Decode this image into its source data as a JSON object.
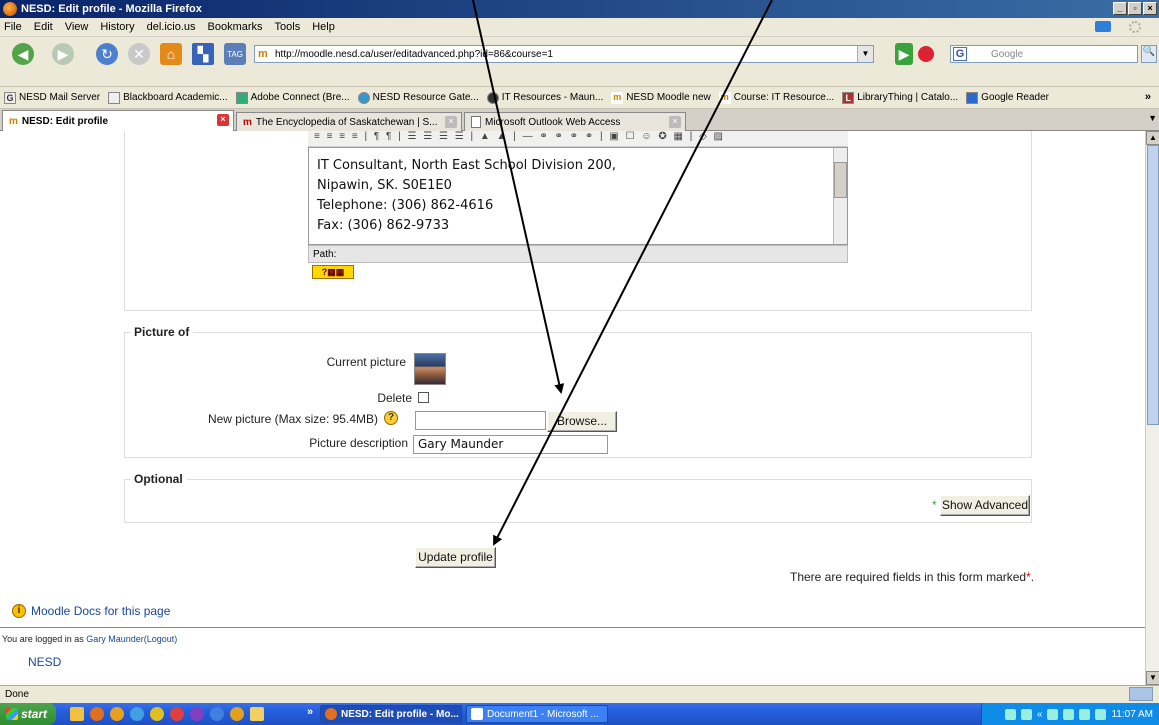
{
  "window": {
    "title": "NESD: Edit profile - Mozilla Firefox"
  },
  "menu": [
    "File",
    "Edit",
    "View",
    "History",
    "del.icio.us",
    "Bookmarks",
    "Tools",
    "Help"
  ],
  "nav": {
    "tag_label": "TAG",
    "url": "http://moodle.nesd.ca/user/editadvanced.php?id=86&course=1",
    "search_placeholder": "Google"
  },
  "bookmarks": [
    "NESD Mail Server",
    "Blackboard Academic...",
    "Adobe Connect (Bre...",
    "NESD Resource Gate...",
    "IT Resources - Maun...",
    "NESD Moodle new",
    "Course: IT Resource...",
    "LibraryThing | Catalo...",
    "Google Reader"
  ],
  "bookmarks_more": "»",
  "tabs": [
    {
      "label": "NESD: Edit profile"
    },
    {
      "label": "The Encyclopedia of Saskatchewan | S..."
    },
    {
      "label": "Microsoft Outlook Web Access"
    }
  ],
  "editor": {
    "lines": [
      "IT Consultant, North East School Division 200,",
      "Nipawin, SK. S0E1E0",
      "Telephone: (306) 862-4616",
      "Fax: (306) 862-9733"
    ],
    "path_label": "Path:",
    "toolbar_glyphs": "≡ ≡ ≡ ≡ | ¶ ¶ | ☰ ☰ ☰ ☰ | ▲ ▲ | — ⚭ ⚭ ⚭ ⚭ | ▣ ☐ ☺ ✪ ▦ | ◇ ▨"
  },
  "picture": {
    "legend": "Picture of",
    "current_label": "Current picture",
    "delete_label": "Delete",
    "new_label": "New picture (Max size: 95.4MB)",
    "browse_label": "Browse...",
    "description_label": "Picture description",
    "description_value": "Gary Maunder"
  },
  "optional": {
    "legend": "Optional",
    "star": "*",
    "show_advanced": "Show Advanced"
  },
  "update_button": "Update profile",
  "required_note": "There are required fields in this form marked",
  "required_star": "*",
  "required_end": ".",
  "docs_link": "Moodle Docs for this page",
  "login": {
    "prefix": "You are logged in as ",
    "user": "Gary Maunder",
    "logout": "(Logout)"
  },
  "home_link": "NESD",
  "status": "Done",
  "taskbar": {
    "start": "start",
    "more": "»",
    "items": [
      "NESD: Edit profile - Mo...",
      "Document1 - Microsoft ..."
    ],
    "tray_more": "«",
    "time": "11:07 AM"
  }
}
